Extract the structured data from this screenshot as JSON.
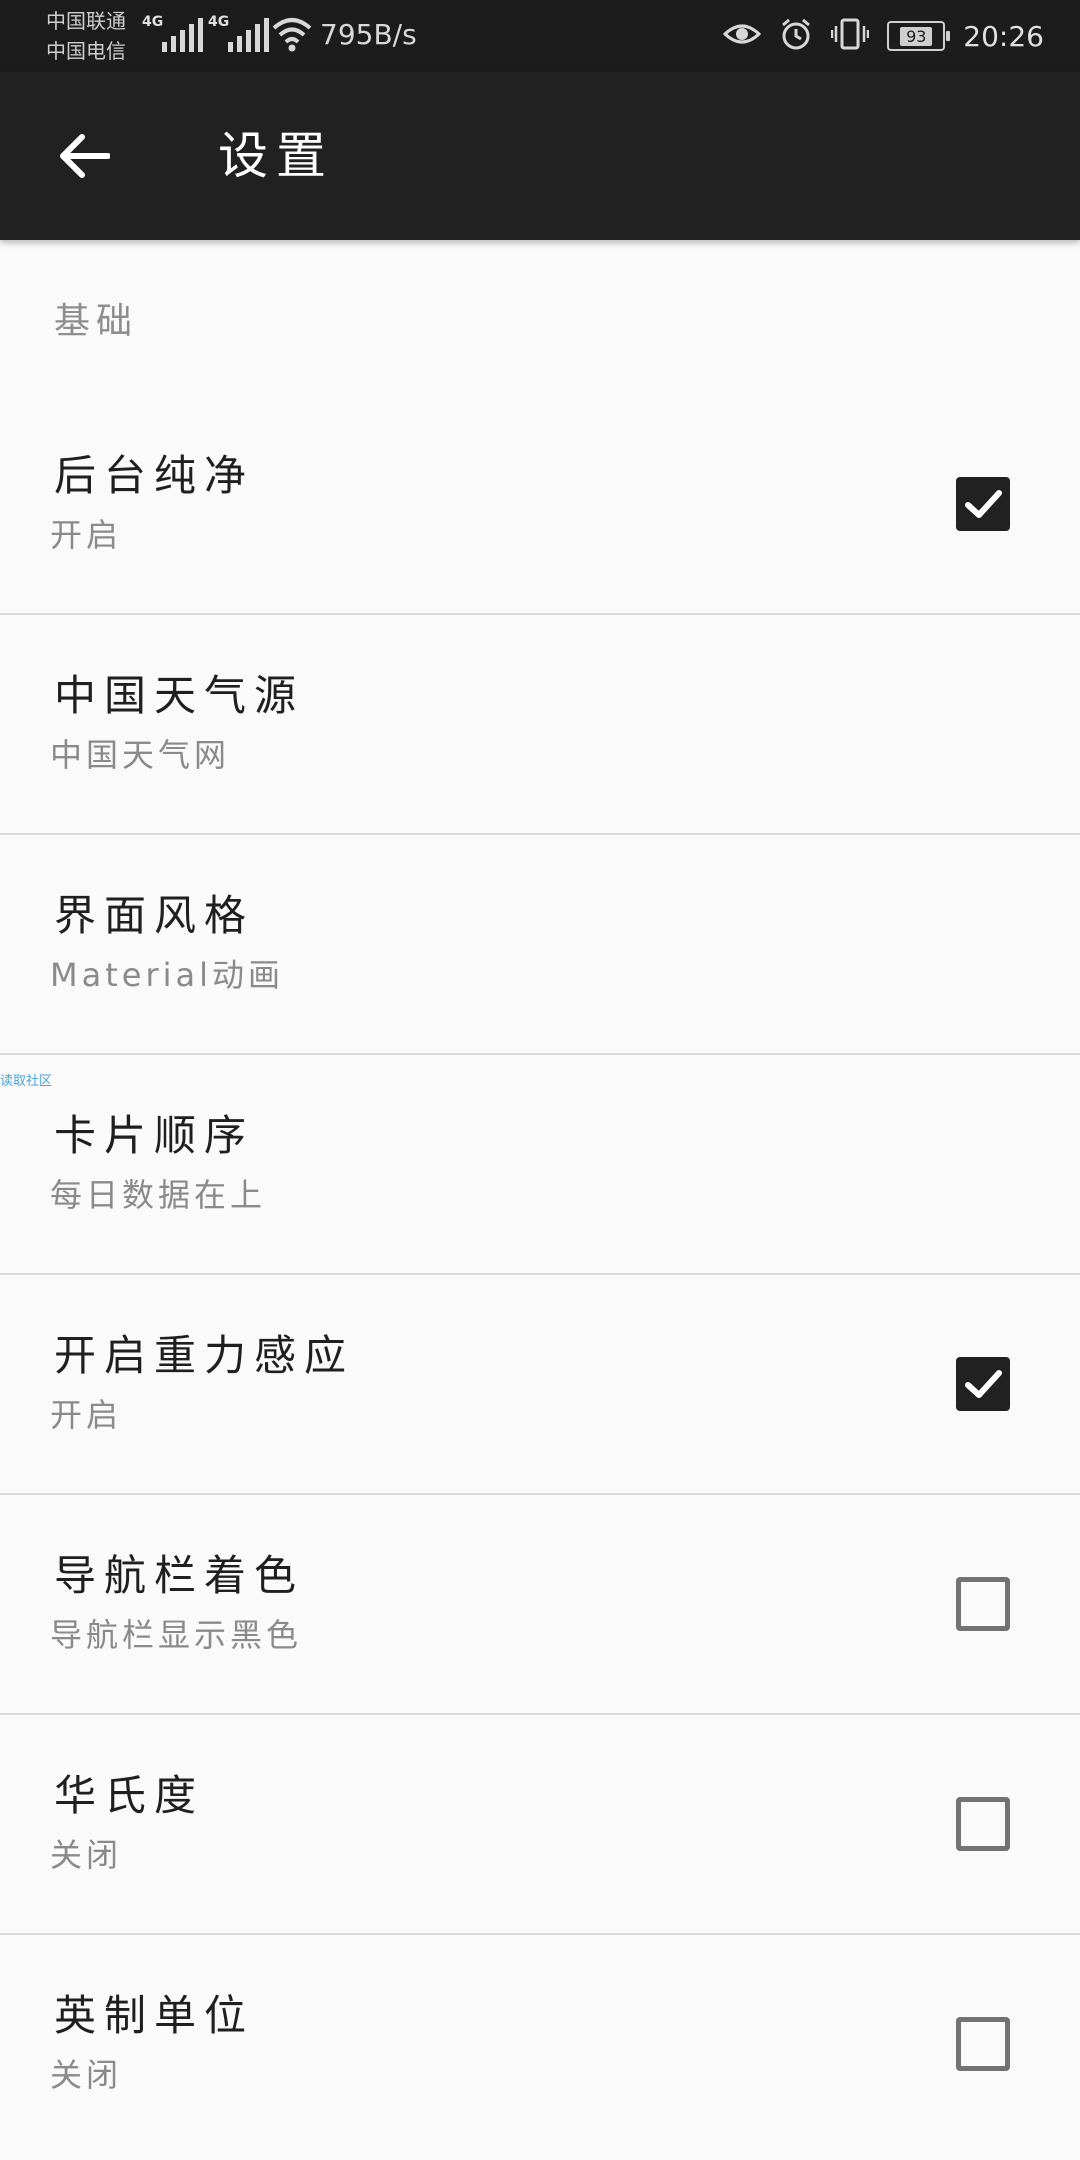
{
  "status_bar": {
    "carrier1": "中国联通",
    "carrier2": "中国电信",
    "net1": "4G",
    "net2": "4G",
    "speed": "795B/s",
    "battery": "93",
    "time": "20:26"
  },
  "toolbar": {
    "title": "设置"
  },
  "section": {
    "label": "基础"
  },
  "watermark": "读取社区",
  "preferences": [
    {
      "title": "后台纯净",
      "summary": "开启",
      "control": "checkbox",
      "checked": true
    },
    {
      "title": "中国天气源",
      "summary": "中国天气网",
      "control": "none",
      "checked": false
    },
    {
      "title": "界面风格",
      "summary": "Material动画",
      "control": "none",
      "checked": false
    },
    {
      "title": "卡片顺序",
      "summary": "每日数据在上",
      "control": "none",
      "checked": false
    },
    {
      "title": "开启重力感应",
      "summary": "开启",
      "control": "checkbox",
      "checked": true
    },
    {
      "title": "导航栏着色",
      "summary": "导航栏显示黑色",
      "control": "checkbox",
      "checked": false
    },
    {
      "title": "华氏度",
      "summary": "关闭",
      "control": "checkbox",
      "checked": false
    },
    {
      "title": "英制单位",
      "summary": "关闭",
      "control": "checkbox",
      "checked": false
    }
  ]
}
